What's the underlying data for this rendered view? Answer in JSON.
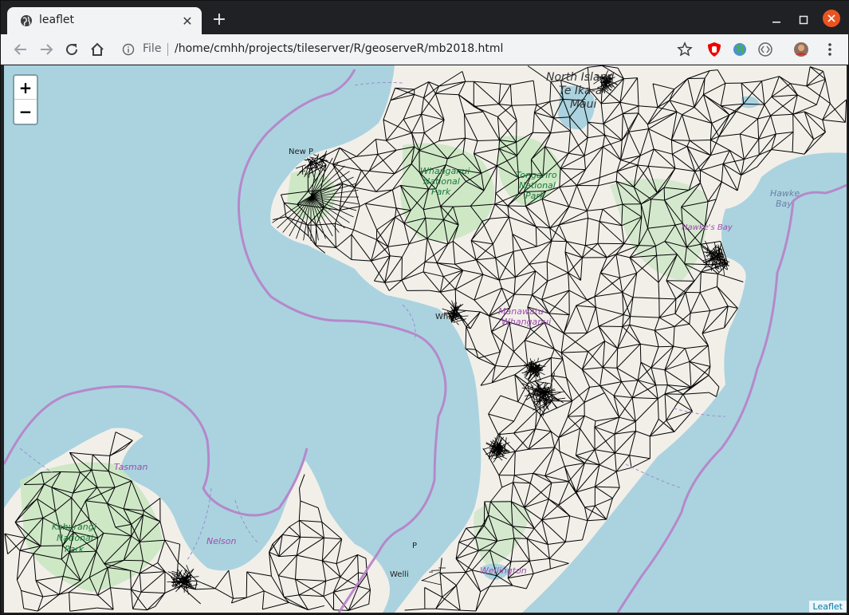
{
  "browser": {
    "tab_title": "leaflet",
    "tab_close": "✕",
    "new_tab": "+",
    "omnibox": {
      "scheme_label": "File",
      "url": "/home/cmhh/projects/tileserver/R/geoserveR/mb2018.html"
    }
  },
  "map": {
    "zoom_in": "+",
    "zoom_out": "−",
    "attribution": "Leaflet",
    "labels": {
      "north_island": "North Island",
      "te_ika": "Te Ika-a-",
      "maui": "Māui",
      "whanganui_np_1": "Whanganui",
      "whanganui_np_2": "National",
      "whanganui_np_3": "Park",
      "tongariro_np_1": "Tongariro",
      "tongariro_np_2": "National",
      "tongariro_np_3": "Park",
      "hawke_1": "Hawke",
      "hawke_2": "Bay",
      "new_plymouth": "New P",
      "whanganui": "Wh",
      "manawatu_1": "Manawatu-",
      "manawatu_2": "Whanganui",
      "tasman": "Tasman",
      "kahurangi_1": "Kahurangi",
      "kahurangi_2": "National",
      "kahurangi_3": "Park",
      "nelson": "Nelson",
      "wellington": "Wellington",
      "wellington_city": "Welli",
      "porirua": "P",
      "hawkes_bay_region": "Hawke's Bay"
    },
    "colors": {
      "water": "#aad3df",
      "land": "#f2efe9",
      "park": "#c8e6c0",
      "boundary": "#b77fc9",
      "mesh": "#000000"
    }
  }
}
